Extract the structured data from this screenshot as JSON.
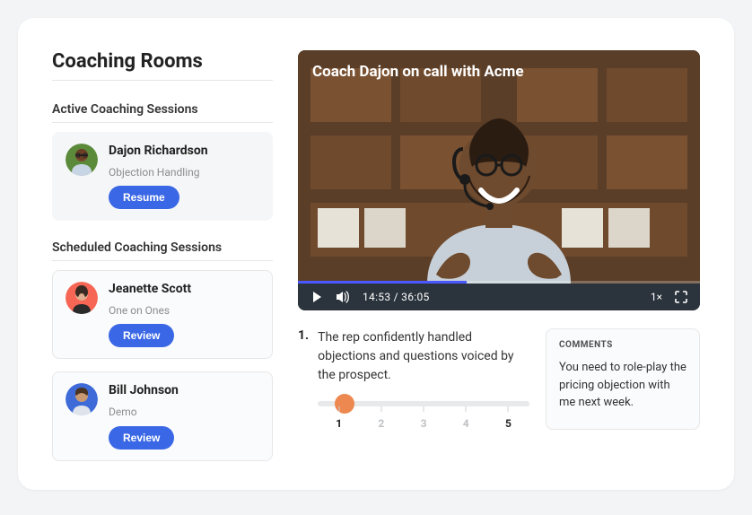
{
  "page_title": "Coaching Rooms",
  "active": {
    "heading": "Active Coaching Sessions",
    "sessions": [
      {
        "name": "Dajon Richardson",
        "topic": "Objection Handling",
        "button": "Resume"
      }
    ]
  },
  "scheduled": {
    "heading": "Scheduled Coaching Sessions",
    "sessions": [
      {
        "name": "Jeanette Scott",
        "topic": "One on Ones",
        "button": "Review"
      },
      {
        "name": "Bill Johnson",
        "topic": "Demo",
        "button": "Review"
      }
    ]
  },
  "video": {
    "title": "Coach Dajon on call with Acme",
    "current_time": "14:53",
    "total_time": "36:05",
    "time_display": "14:53 / 36:05",
    "speed": "1×",
    "progress_percent": 42
  },
  "rating": {
    "number": "1.",
    "text": "The rep confidently handled objections and questions voiced by the prospect.",
    "scale": {
      "min": 1,
      "max": 5
    },
    "ticks": [
      "1",
      "2",
      "3",
      "4",
      "5"
    ],
    "selected_index": 0
  },
  "comments": {
    "heading": "COMMENTS",
    "text": "You need to role-play the pricing objection with me next week."
  },
  "colors": {
    "accent": "#3a67e5",
    "slider_thumb": "#ec8850"
  }
}
